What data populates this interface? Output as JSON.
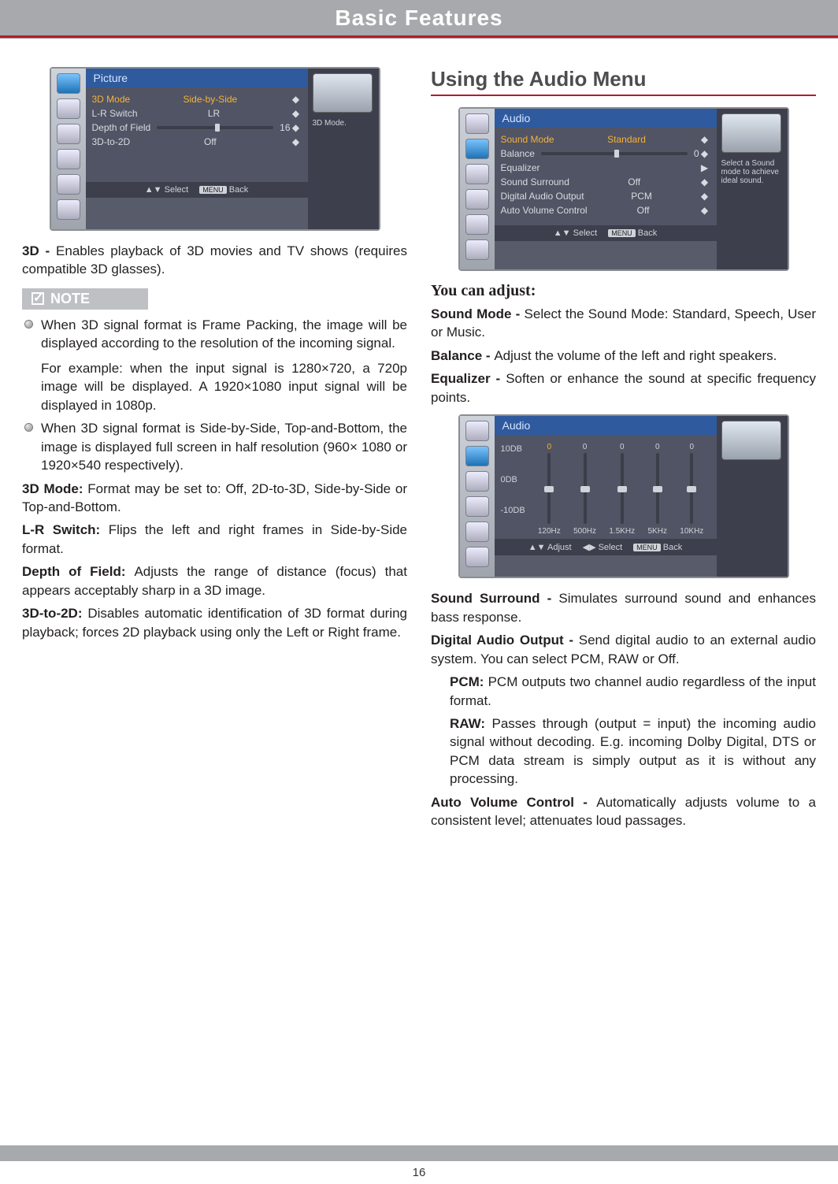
{
  "page": {
    "header": "Basic Features",
    "number": "16"
  },
  "pictureOsd": {
    "title": "Picture",
    "rows": [
      {
        "label": "3D Mode",
        "value": "Side-by-Side",
        "selected": true
      },
      {
        "label": "L-R Switch",
        "value": "LR",
        "selected": false
      },
      {
        "label": "Depth of Field",
        "value": "16",
        "slider": true,
        "selected": false
      },
      {
        "label": "3D-to-2D",
        "value": "Off",
        "selected": false
      }
    ],
    "info": "3D Mode.",
    "footerSelect": "Select",
    "footerBack": "Back",
    "footerMenu": "MENU"
  },
  "audioOsd": {
    "title": "Audio",
    "rows": [
      {
        "label": "Sound Mode",
        "value": "Standard",
        "selected": true
      },
      {
        "label": "Balance",
        "value": "0",
        "slider": true
      },
      {
        "label": "Equalizer",
        "value": "",
        "chevron": true
      },
      {
        "label": "Sound Surround",
        "value": "Off"
      },
      {
        "label": "Digital Audio Output",
        "value": "PCM"
      },
      {
        "label": "Auto Volume Control",
        "value": "Off"
      }
    ],
    "info": "Select a Sound mode to achieve ideal sound.",
    "footerSelect": "Select",
    "footerBack": "Back",
    "footerMenu": "MENU"
  },
  "eqOsd": {
    "title": "Audio",
    "yLabels": [
      "10DB",
      "0DB",
      "-10DB"
    ],
    "bands": [
      {
        "freq": "120Hz",
        "val": "0",
        "selected": true
      },
      {
        "freq": "500Hz",
        "val": "0"
      },
      {
        "freq": "1.5KHz",
        "val": "0"
      },
      {
        "freq": "5KHz",
        "val": "0"
      },
      {
        "freq": "10KHz",
        "val": "0"
      }
    ],
    "footerAdjust": "Adjust",
    "footerSelect": "Select",
    "footerBack": "Back",
    "footerMenu": "MENU"
  },
  "left": {
    "intro_b": "3D - ",
    "intro": "Enables playback of 3D movies and TV shows (requires compatible 3D glasses).",
    "noteLabel": "NOTE",
    "note1": "When 3D signal format is Frame Packing, the image will be displayed according to the resolution of the incoming signal.",
    "note1b": "For example: when the input signal is 1280×720, a 720p image will be displayed. A 1920×1080 input signal will be displayed in 1080p.",
    "note2": "When 3D signal format is Side-by-Side, Top-and-Bottom, the image is displayed full screen in half resolution (960× 1080 or 1920×540 respectively).",
    "mode_b": "3D Mode: ",
    "mode": "Format may be set to: Off, 2D-to-3D, Side-by-Side or Top-and-Bottom.",
    "lr_b": "L-R Switch: ",
    "lr": "Flips the left and right frames in Side-by-Side format.",
    "dof_b": "Depth of Field: ",
    "dof": "Adjusts the range of distance (focus) that appears acceptably sharp in a 3D image.",
    "t2d_b": "3D-to-2D: ",
    "t2d": "Disables automatic identification of 3D format during playback; forces 2D playback using only the Left or Right frame."
  },
  "right": {
    "heading": "Using the Audio Menu",
    "adjustHeading": "You can adjust:",
    "sm_b": "Sound Mode - ",
    "sm": "Select the Sound Mode: Standard, Speech, User or Music.",
    "bal_b": "Balance - ",
    "bal": "Adjust the volume of the left and right speakers.",
    "eq_b": "Equalizer - ",
    "eq": "Soften or enhance the sound at specific frequency points.",
    "ss_b": "Sound Surround - ",
    "ss": "Simulates surround sound and enhances bass response.",
    "dao_b": "Digital Audio Output - ",
    "dao": "Send digital audio to an external audio system. You can select PCM, RAW or Off.",
    "pcm_b": "PCM: ",
    "pcm": "PCM outputs two channel audio regardless of the input format.",
    "raw_b": "RAW: ",
    "raw": "Passes through (output = input) the incoming audio signal without decoding. E.g. incoming Dolby Digital, DTS or PCM data stream is simply output as it is without any processing.",
    "avc_b": "Auto Volume Control - ",
    "avc": "Automatically adjusts volume to a consistent level; attenuates loud passages."
  }
}
